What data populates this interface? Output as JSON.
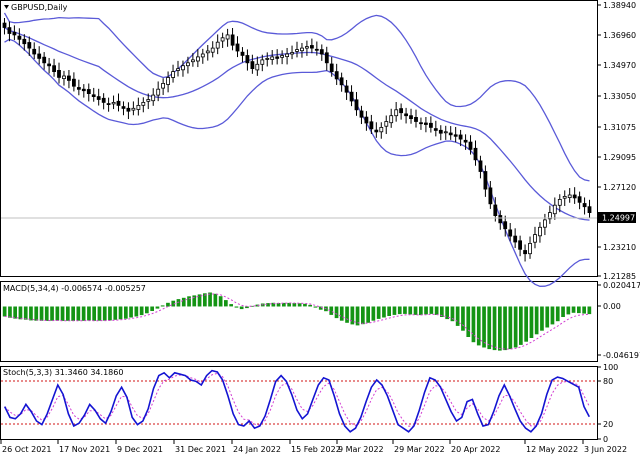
{
  "symbol_label": "GBPUSD,Daily",
  "price_axis_labels": [
    "1.38940",
    "1.36960",
    "1.34970",
    "1.33050",
    "1.31075",
    "1.29095",
    "1.27120",
    "1.23210",
    "1.21285"
  ],
  "current_price": "1.24997",
  "macd": {
    "title": "MACD(5,34,4) -0.006574 -0.005257",
    "axis_labels": [
      "0.020417",
      "0.00",
      "-0.046197"
    ]
  },
  "stoch": {
    "title": "Stoch(5,3,3) 31.3460 34.1860",
    "axis_labels": [
      "100",
      "80",
      "20",
      "0"
    ]
  },
  "date_labels": [
    "26 Oct 2021",
    "17 Nov 2021",
    "9 Dec 2021",
    "31 Dec 2021",
    "24 Jan 2022",
    "15 Feb 2022",
    "9 Mar 2022",
    "29 Mar 2022",
    "20 Apr 2022",
    "12 May 2022",
    "3 Jun 2022"
  ],
  "colors": {
    "bollinger": "#5a5ad8",
    "macd_hist": "#149414",
    "macd_signal": "#d23cd2",
    "stoch_main": "#1414d2",
    "stoch_signal": "#d23cd2",
    "level_line": "#d21414"
  },
  "chart_data": [
    {
      "type": "candlestick",
      "title": "GBPUSD,Daily",
      "ylim": [
        1.2075,
        1.3934
      ],
      "close": [
        1.376,
        1.372,
        1.371,
        1.368,
        1.365,
        1.362,
        1.358,
        1.355,
        1.352,
        1.35,
        1.346,
        1.342,
        1.343,
        1.34,
        1.336,
        1.334,
        1.333,
        1.331,
        1.329,
        1.327,
        1.325,
        1.324,
        1.325,
        1.323,
        1.321,
        1.319,
        1.321,
        1.323,
        1.325,
        1.327,
        1.33,
        1.334,
        1.338,
        1.342,
        1.346,
        1.348,
        1.35,
        1.352,
        1.354,
        1.356,
        1.358,
        1.36,
        1.362,
        1.366,
        1.369,
        1.371,
        1.364,
        1.36,
        1.357,
        1.352,
        1.348,
        1.351,
        1.354,
        1.355,
        1.356,
        1.355,
        1.357,
        1.358,
        1.359,
        1.361,
        1.362,
        1.363,
        1.362,
        1.361,
        1.358,
        1.352,
        1.346,
        1.341,
        1.337,
        1.332,
        1.326,
        1.32,
        1.315,
        1.311,
        1.307,
        1.305,
        1.308,
        1.312,
        1.316,
        1.32,
        1.318,
        1.316,
        1.314,
        1.312,
        1.311,
        1.31,
        1.308,
        1.306,
        1.304,
        1.305,
        1.303,
        1.302,
        1.3,
        1.298,
        1.293,
        1.286,
        1.278,
        1.266,
        1.256,
        1.248,
        1.243,
        1.239,
        1.234,
        1.23,
        1.225,
        1.222,
        1.229,
        1.235,
        1.24,
        1.245,
        1.25,
        1.255,
        1.259,
        1.261,
        1.262,
        1.26,
        1.257,
        1.254,
        1.25
      ]
    },
    {
      "type": "bar",
      "title": "MACD(5,34,4) -0.006574 -0.005257",
      "ylim": [
        -0.046197,
        0.020417
      ],
      "histogram": [
        -0.0095,
        -0.0108,
        -0.0115,
        -0.0122,
        -0.0126,
        -0.0132,
        -0.0135,
        -0.0136,
        -0.0137,
        -0.0135,
        -0.0134,
        -0.0137,
        -0.0136,
        -0.0137,
        -0.0135,
        -0.0136,
        -0.0133,
        -0.0136,
        -0.0135,
        -0.0134,
        -0.0132,
        -0.0127,
        -0.0122,
        -0.0116,
        -0.0105,
        -0.0095,
        -0.0082,
        -0.0065,
        -0.0043,
        -0.002,
        0.001,
        0.0035,
        0.0055,
        0.007,
        0.0082,
        0.0097,
        0.0105,
        0.0115,
        0.0125,
        0.0133,
        0.012,
        0.0098,
        0.006,
        0.0022,
        -0.001,
        -0.0025,
        -0.0015,
        0.0005,
        0.0018,
        0.0028,
        0.0032,
        0.0035,
        0.0033,
        0.0034,
        0.0034,
        0.0032,
        0.003,
        0.0025,
        0.0015,
        -0.001,
        -0.003,
        -0.0045,
        -0.008,
        -0.011,
        -0.0135,
        -0.0155,
        -0.017,
        -0.018,
        -0.0168,
        -0.0155,
        -0.0135,
        -0.0118,
        -0.0105,
        -0.009,
        -0.008,
        -0.0072,
        -0.007,
        -0.0075,
        -0.008,
        -0.0082,
        -0.0075,
        -0.007,
        -0.008,
        -0.01,
        -0.012,
        -0.014,
        -0.0185,
        -0.023,
        -0.029,
        -0.034,
        -0.037,
        -0.039,
        -0.0405,
        -0.0415,
        -0.042,
        -0.0415,
        -0.0405,
        -0.039,
        -0.0365,
        -0.0335,
        -0.03,
        -0.0265,
        -0.023,
        -0.02,
        -0.017,
        -0.014,
        -0.01,
        -0.0075,
        -0.006,
        -0.0063,
        -0.0068,
        -0.0072
      ]
    },
    {
      "type": "line",
      "title": "Stoch(5,3,3) 31.3460 34.1860",
      "ylim": [
        0,
        100
      ],
      "levels": [
        80,
        20
      ],
      "series": [
        {
          "values": [
            45,
            30,
            28,
            35,
            48,
            38,
            25,
            20,
            35,
            55,
            75,
            62,
            35,
            18,
            22,
            33,
            48,
            40,
            28,
            22,
            38,
            60,
            72,
            58,
            30,
            20,
            25,
            42,
            70,
            88,
            92,
            85,
            92,
            90,
            88,
            82,
            80,
            75,
            88,
            95,
            93,
            82,
            60,
            35,
            20,
            18,
            25,
            15,
            18,
            32,
            55,
            80,
            88,
            80,
            62,
            40,
            28,
            35,
            55,
            75,
            85,
            82,
            60,
            35,
            18,
            10,
            15,
            30,
            52,
            72,
            82,
            75,
            60,
            40,
            20,
            15,
            10,
            18,
            40,
            65,
            85,
            82,
            72,
            55,
            38,
            25,
            30,
            52,
            55,
            35,
            18,
            20,
            38,
            60,
            75,
            60,
            42,
            25,
            15,
            10,
            18,
            35,
            62,
            82,
            86,
            84,
            80,
            76,
            72,
            45,
            31
          ]
        }
      ]
    }
  ]
}
